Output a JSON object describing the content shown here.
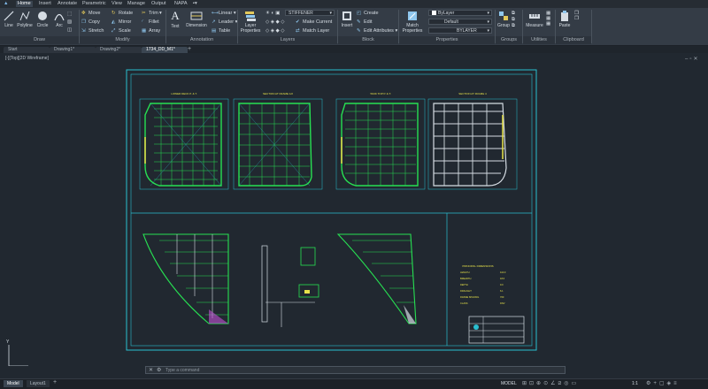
{
  "ribbon_tabs": [
    "Home",
    "Insert",
    "Annotate",
    "Parametric",
    "View",
    "Manage",
    "Output",
    "NAPA"
  ],
  "active_tab": "Home",
  "draw": {
    "line": "Line",
    "polyline": "Polyline",
    "circle": "Circle",
    "arc": "Arc",
    "panel": "Draw"
  },
  "modify": {
    "move": "Move",
    "rotate": "Rotate",
    "trim": "Trim",
    "copy": "Copy",
    "mirror": "Mirror",
    "fillet": "Fillet",
    "stretch": "Stretch",
    "scale": "Scale",
    "array": "Array",
    "panel": "Modify"
  },
  "annotation": {
    "text": "Text",
    "dimension": "Dimension",
    "linear": "Linear",
    "leader": "Leader",
    "table": "Table",
    "panel": "Annotation"
  },
  "layers": {
    "layer_properties": "Layer Properties",
    "current_layer": "STIFFENER",
    "make_current": "Make Current",
    "match_layer": "Match Layer",
    "panel": "Layers"
  },
  "block": {
    "insert": "Insert",
    "create": "Create",
    "edit": "Edit",
    "edit_attributes": "Edit Attributes",
    "panel": "Block"
  },
  "properties": {
    "match_properties": "Match Properties",
    "color": "ByLayer",
    "linetype": "Default",
    "lineweight": "BYLAYER",
    "panel": "Properties"
  },
  "groups": {
    "group": "Group",
    "panel": "Groups"
  },
  "utilities": {
    "measure": "Measure",
    "panel": "Utilities"
  },
  "clipboard": {
    "paste": "Paste",
    "panel": "Clipboard"
  },
  "doc_tabs": [
    "Start",
    "Drawing1*",
    "Drawing2*",
    "1734_DD_M1*"
  ],
  "active_doc": "1734_DD_M1*",
  "view_label": "[-][Top][2D Wireframe]",
  "drawing_notes": {
    "plan_titles": [
      "LOWER DECK P. & T.",
      "SECTION AT FRAME 1/2",
      "TANK TOP P. & T.",
      "SECTION AT FRAME 4"
    ],
    "table_title": "PRINCIPAL DIMENSIONS",
    "table_rows": [
      {
        "label": "LENGTH",
        "value": "110.0"
      },
      {
        "label": "BREADTH",
        "value": "18.6"
      },
      {
        "label": "DEPTH",
        "value": "9.0"
      },
      {
        "label": "DRAUGHT",
        "value": "6.1"
      },
      {
        "label": "FRAME SPACING",
        "value": "700"
      },
      {
        "label": "CLASS",
        "value": "DNV"
      }
    ]
  },
  "command_placeholder": "Type a command",
  "layout_tabs": [
    "Model",
    "Layout1"
  ],
  "active_layout": "Model",
  "status": {
    "mode": "MODEL",
    "scale": "1:1"
  },
  "colors": {
    "ribbon": "#343c46",
    "canvas": "#212830",
    "drawing": "#27e052",
    "frame": "#29bfd0",
    "accent": "#e7e24a",
    "magenta": "#c251d6"
  }
}
